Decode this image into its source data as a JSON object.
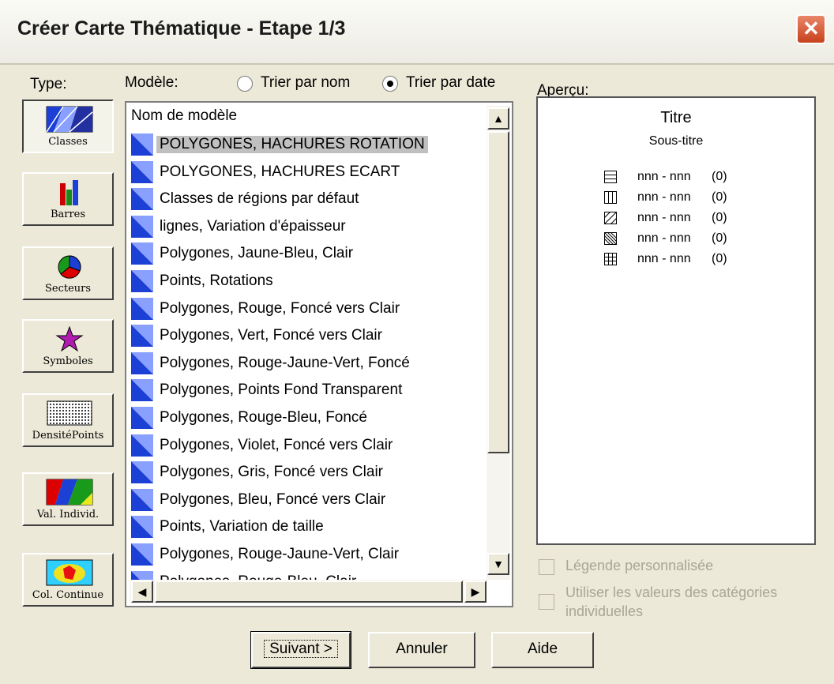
{
  "window": {
    "title": "Créer Carte Thématique - Etape 1/3",
    "close_glyph": "✕"
  },
  "labels": {
    "type": "Type:",
    "model": "Modèle:",
    "preview": "Aperçu:"
  },
  "sort": {
    "by_name": "Trier par nom",
    "by_date": "Trier par date",
    "selected": "by_date"
  },
  "types": [
    {
      "label": "Classes",
      "active": true
    },
    {
      "label": "Barres",
      "active": false
    },
    {
      "label": "Secteurs",
      "active": false
    },
    {
      "label": "Symboles",
      "active": false
    },
    {
      "label": "DensitéPoints",
      "active": false
    },
    {
      "label": "Val. Individ.",
      "active": false
    },
    {
      "label": "Col. Continue",
      "active": false
    }
  ],
  "model_list": {
    "column_header": "Nom de modèle",
    "selected_index": 0,
    "items": [
      "POLYGONES, HACHURES ROTATION",
      "POLYGONES, HACHURES ECART",
      "Classes de régions par défaut",
      "lignes, Variation d'épaisseur",
      "Polygones, Jaune-Bleu, Clair",
      "Points, Rotations",
      "Polygones, Rouge, Foncé vers Clair",
      "Polygones, Vert, Foncé vers Clair",
      "Polygones, Rouge-Jaune-Vert, Foncé",
      "Polygones, Points Fond Transparent",
      "Polygones, Rouge-Bleu, Foncé",
      "Polygones, Violet, Foncé vers Clair",
      "Polygones, Gris, Foncé vers Clair",
      "Polygones, Bleu, Foncé vers Clair",
      "Points, Variation de taille",
      "Polygones, Rouge-Jaune-Vert, Clair",
      "Polygones, Rouge-Bleu, Clair"
    ]
  },
  "preview": {
    "title": "Titre",
    "subtitle": "Sous-titre",
    "legend": [
      {
        "pattern": "horizontal",
        "range": "nnn - nnn",
        "count": "(0)"
      },
      {
        "pattern": "vertical",
        "range": "nnn - nnn",
        "count": "(0)"
      },
      {
        "pattern": "diagonal-up",
        "range": "nnn - nnn",
        "count": "(0)"
      },
      {
        "pattern": "diagonal-down",
        "range": "nnn - nnn",
        "count": "(0)"
      },
      {
        "pattern": "grid",
        "range": "nnn - nnn",
        "count": "(0)"
      }
    ]
  },
  "options": {
    "custom_legend": "Légende personnalisée",
    "individual_values_line1": "Utiliser les valeurs des catégories",
    "individual_values_line2": "individuelles"
  },
  "buttons": {
    "next": "Suivant >",
    "cancel": "Annuler",
    "help": "Aide"
  },
  "colors": {
    "dialog_bg": "#ece9d8",
    "selection": "#c0c0c0",
    "disabled_text": "#a9a597",
    "close_red": "#c8421c"
  }
}
